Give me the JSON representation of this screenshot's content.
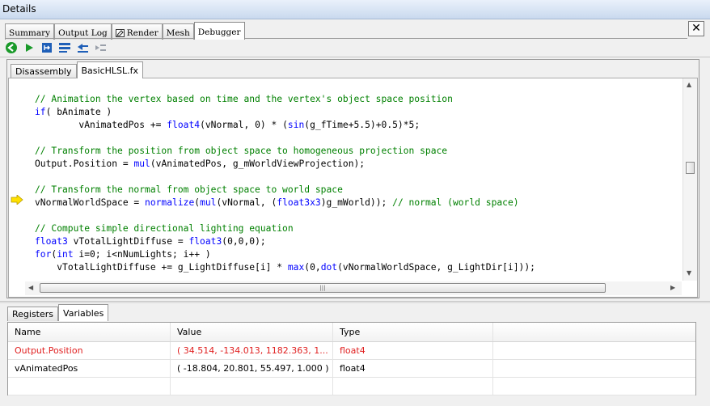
{
  "window": {
    "title": "Details"
  },
  "top_tabs": [
    {
      "label": "Summary",
      "active": false
    },
    {
      "label": "Output Log",
      "active": false
    },
    {
      "label": "Render",
      "active": false,
      "icon": "pencil-icon"
    },
    {
      "label": "Mesh",
      "active": false
    },
    {
      "label": "Debugger",
      "active": true
    }
  ],
  "close_label": "✕",
  "toolbar": {
    "buttons": [
      {
        "name": "back-icon",
        "color": "#1a9a2a"
      },
      {
        "name": "play-icon",
        "color": "#1a9a2a"
      },
      {
        "name": "step-into-icon",
        "color": "#1f5fb8"
      },
      {
        "name": "step-over-icon",
        "color": "#1f5fb8"
      },
      {
        "name": "step-out-icon",
        "color": "#1f5fb8"
      },
      {
        "name": "run-to-cursor-icon",
        "color": "#9aa0aa"
      }
    ]
  },
  "editor_tabs": [
    {
      "label": "Disassembly",
      "active": false
    },
    {
      "label": "BasicHLSL.fx",
      "active": true
    }
  ],
  "code_lines": [
    {
      "indent": "",
      "parts": [
        {
          "t": "// Animation the vertex based on time and the vertex's object space position",
          "c": "cm"
        }
      ]
    },
    {
      "indent": "",
      "parts": [
        {
          "t": "if",
          "c": "kw"
        },
        {
          "t": "( bAnimate )",
          "c": ""
        }
      ]
    },
    {
      "indent": "        ",
      "parts": [
        {
          "t": "vAnimatedPos += ",
          "c": ""
        },
        {
          "t": "float4",
          "c": "kw"
        },
        {
          "t": "(vNormal, 0) * (",
          "c": ""
        },
        {
          "t": "sin",
          "c": "fn"
        },
        {
          "t": "(g_fTime+5.5)+0.5)*5;",
          "c": ""
        }
      ]
    },
    {
      "indent": "",
      "parts": []
    },
    {
      "indent": "",
      "parts": [
        {
          "t": "// Transform the position from object space to homogeneous projection space",
          "c": "cm"
        }
      ]
    },
    {
      "indent": "",
      "parts": [
        {
          "t": "Output.Position = ",
          "c": ""
        },
        {
          "t": "mul",
          "c": "fn"
        },
        {
          "t": "(vAnimatedPos, g_mWorldViewProjection);",
          "c": ""
        }
      ]
    },
    {
      "indent": "",
      "parts": []
    },
    {
      "indent": "",
      "parts": [
        {
          "t": "// Transform the normal from object space to world space",
          "c": "cm"
        }
      ]
    },
    {
      "indent": "",
      "parts": [
        {
          "t": "vNormalWorldSpace = ",
          "c": ""
        },
        {
          "t": "normalize",
          "c": "fn"
        },
        {
          "t": "(",
          "c": ""
        },
        {
          "t": "mul",
          "c": "fn"
        },
        {
          "t": "(vNormal, (",
          "c": ""
        },
        {
          "t": "float3x3",
          "c": "kw"
        },
        {
          "t": ")g_mWorld)); ",
          "c": ""
        },
        {
          "t": "// normal (world space)",
          "c": "cm"
        }
      ]
    },
    {
      "indent": "",
      "parts": []
    },
    {
      "indent": "",
      "parts": [
        {
          "t": "// Compute simple directional lighting equation",
          "c": "cm"
        }
      ]
    },
    {
      "indent": "",
      "parts": [
        {
          "t": "float3",
          "c": "kw"
        },
        {
          "t": " vTotalLightDiffuse = ",
          "c": ""
        },
        {
          "t": "float3",
          "c": "kw"
        },
        {
          "t": "(0,0,0);",
          "c": ""
        }
      ]
    },
    {
      "indent": "",
      "parts": [
        {
          "t": "for",
          "c": "kw"
        },
        {
          "t": "(",
          "c": ""
        },
        {
          "t": "int",
          "c": "kw"
        },
        {
          "t": " i=0; i<nNumLights; i++ )",
          "c": ""
        }
      ]
    },
    {
      "indent": "    ",
      "parts": [
        {
          "t": "vTotalLightDiffuse += g_LightDiffuse[i] * ",
          "c": ""
        },
        {
          "t": "max",
          "c": "fn"
        },
        {
          "t": "(0,",
          "c": ""
        },
        {
          "t": "dot",
          "c": "fn"
        },
        {
          "t": "(vNormalWorldSpace, g_LightDir[i]));",
          "c": ""
        }
      ]
    }
  ],
  "current_line_index": 8,
  "bottom_tabs": [
    {
      "label": "Registers",
      "active": false
    },
    {
      "label": "Variables",
      "active": true
    }
  ],
  "variables": {
    "headers": [
      "Name",
      "Value",
      "Type",
      ""
    ],
    "rows": [
      {
        "name": "Output.Position",
        "value": "( 34.514, -134.013, 1182.363, 1...",
        "type": "float4",
        "changed": true
      },
      {
        "name": "vAnimatedPos",
        "value": "( -18.804, 20.801, 55.497, 1.000 )",
        "type": "float4",
        "changed": false
      }
    ]
  },
  "colors": {
    "comment": "#008000",
    "keyword": "#0000ff",
    "changed_value": "#e02020"
  }
}
